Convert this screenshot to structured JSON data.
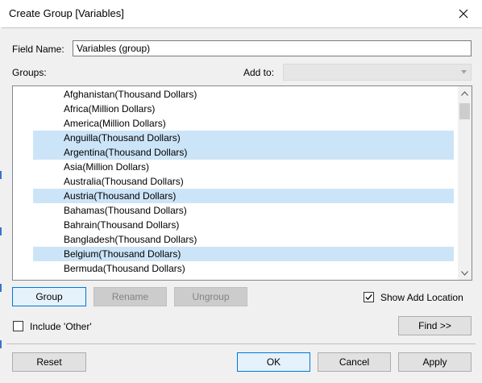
{
  "window": {
    "title": "Create Group [Variables]"
  },
  "field_name": {
    "label": "Field Name:",
    "value": "Variables (group)"
  },
  "groups": {
    "label": "Groups:"
  },
  "add_to": {
    "label": "Add to:",
    "value": ""
  },
  "list": {
    "items": [
      {
        "label": "Afghanistan(Thousand Dollars)",
        "selected": false
      },
      {
        "label": "Africa(Million Dollars)",
        "selected": false
      },
      {
        "label": "America(Million Dollars)",
        "selected": false
      },
      {
        "label": "Anguilla(Thousand Dollars)",
        "selected": true
      },
      {
        "label": "Argentina(Thousand Dollars)",
        "selected": true
      },
      {
        "label": "Asia(Million Dollars)",
        "selected": false
      },
      {
        "label": "Australia(Thousand Dollars)",
        "selected": false
      },
      {
        "label": "Austria(Thousand Dollars)",
        "selected": true
      },
      {
        "label": "Bahamas(Thousand Dollars)",
        "selected": false
      },
      {
        "label": "Bahrain(Thousand Dollars)",
        "selected": false
      },
      {
        "label": "Bangladesh(Thousand Dollars)",
        "selected": false
      },
      {
        "label": "Belgium(Thousand Dollars)",
        "selected": true
      },
      {
        "label": "Bermuda(Thousand Dollars)",
        "selected": false
      }
    ]
  },
  "buttons": {
    "group": "Group",
    "rename": "Rename",
    "ungroup": "Ungroup",
    "find": "Find >>",
    "reset": "Reset",
    "ok": "OK",
    "cancel": "Cancel",
    "apply": "Apply"
  },
  "options": {
    "show_add_location": {
      "label": "Show Add Location",
      "checked": true
    },
    "include_other": {
      "label": "Include 'Other'",
      "checked": false
    }
  },
  "colors": {
    "selection": "#cce4f7",
    "focus_border": "#0078d7"
  }
}
